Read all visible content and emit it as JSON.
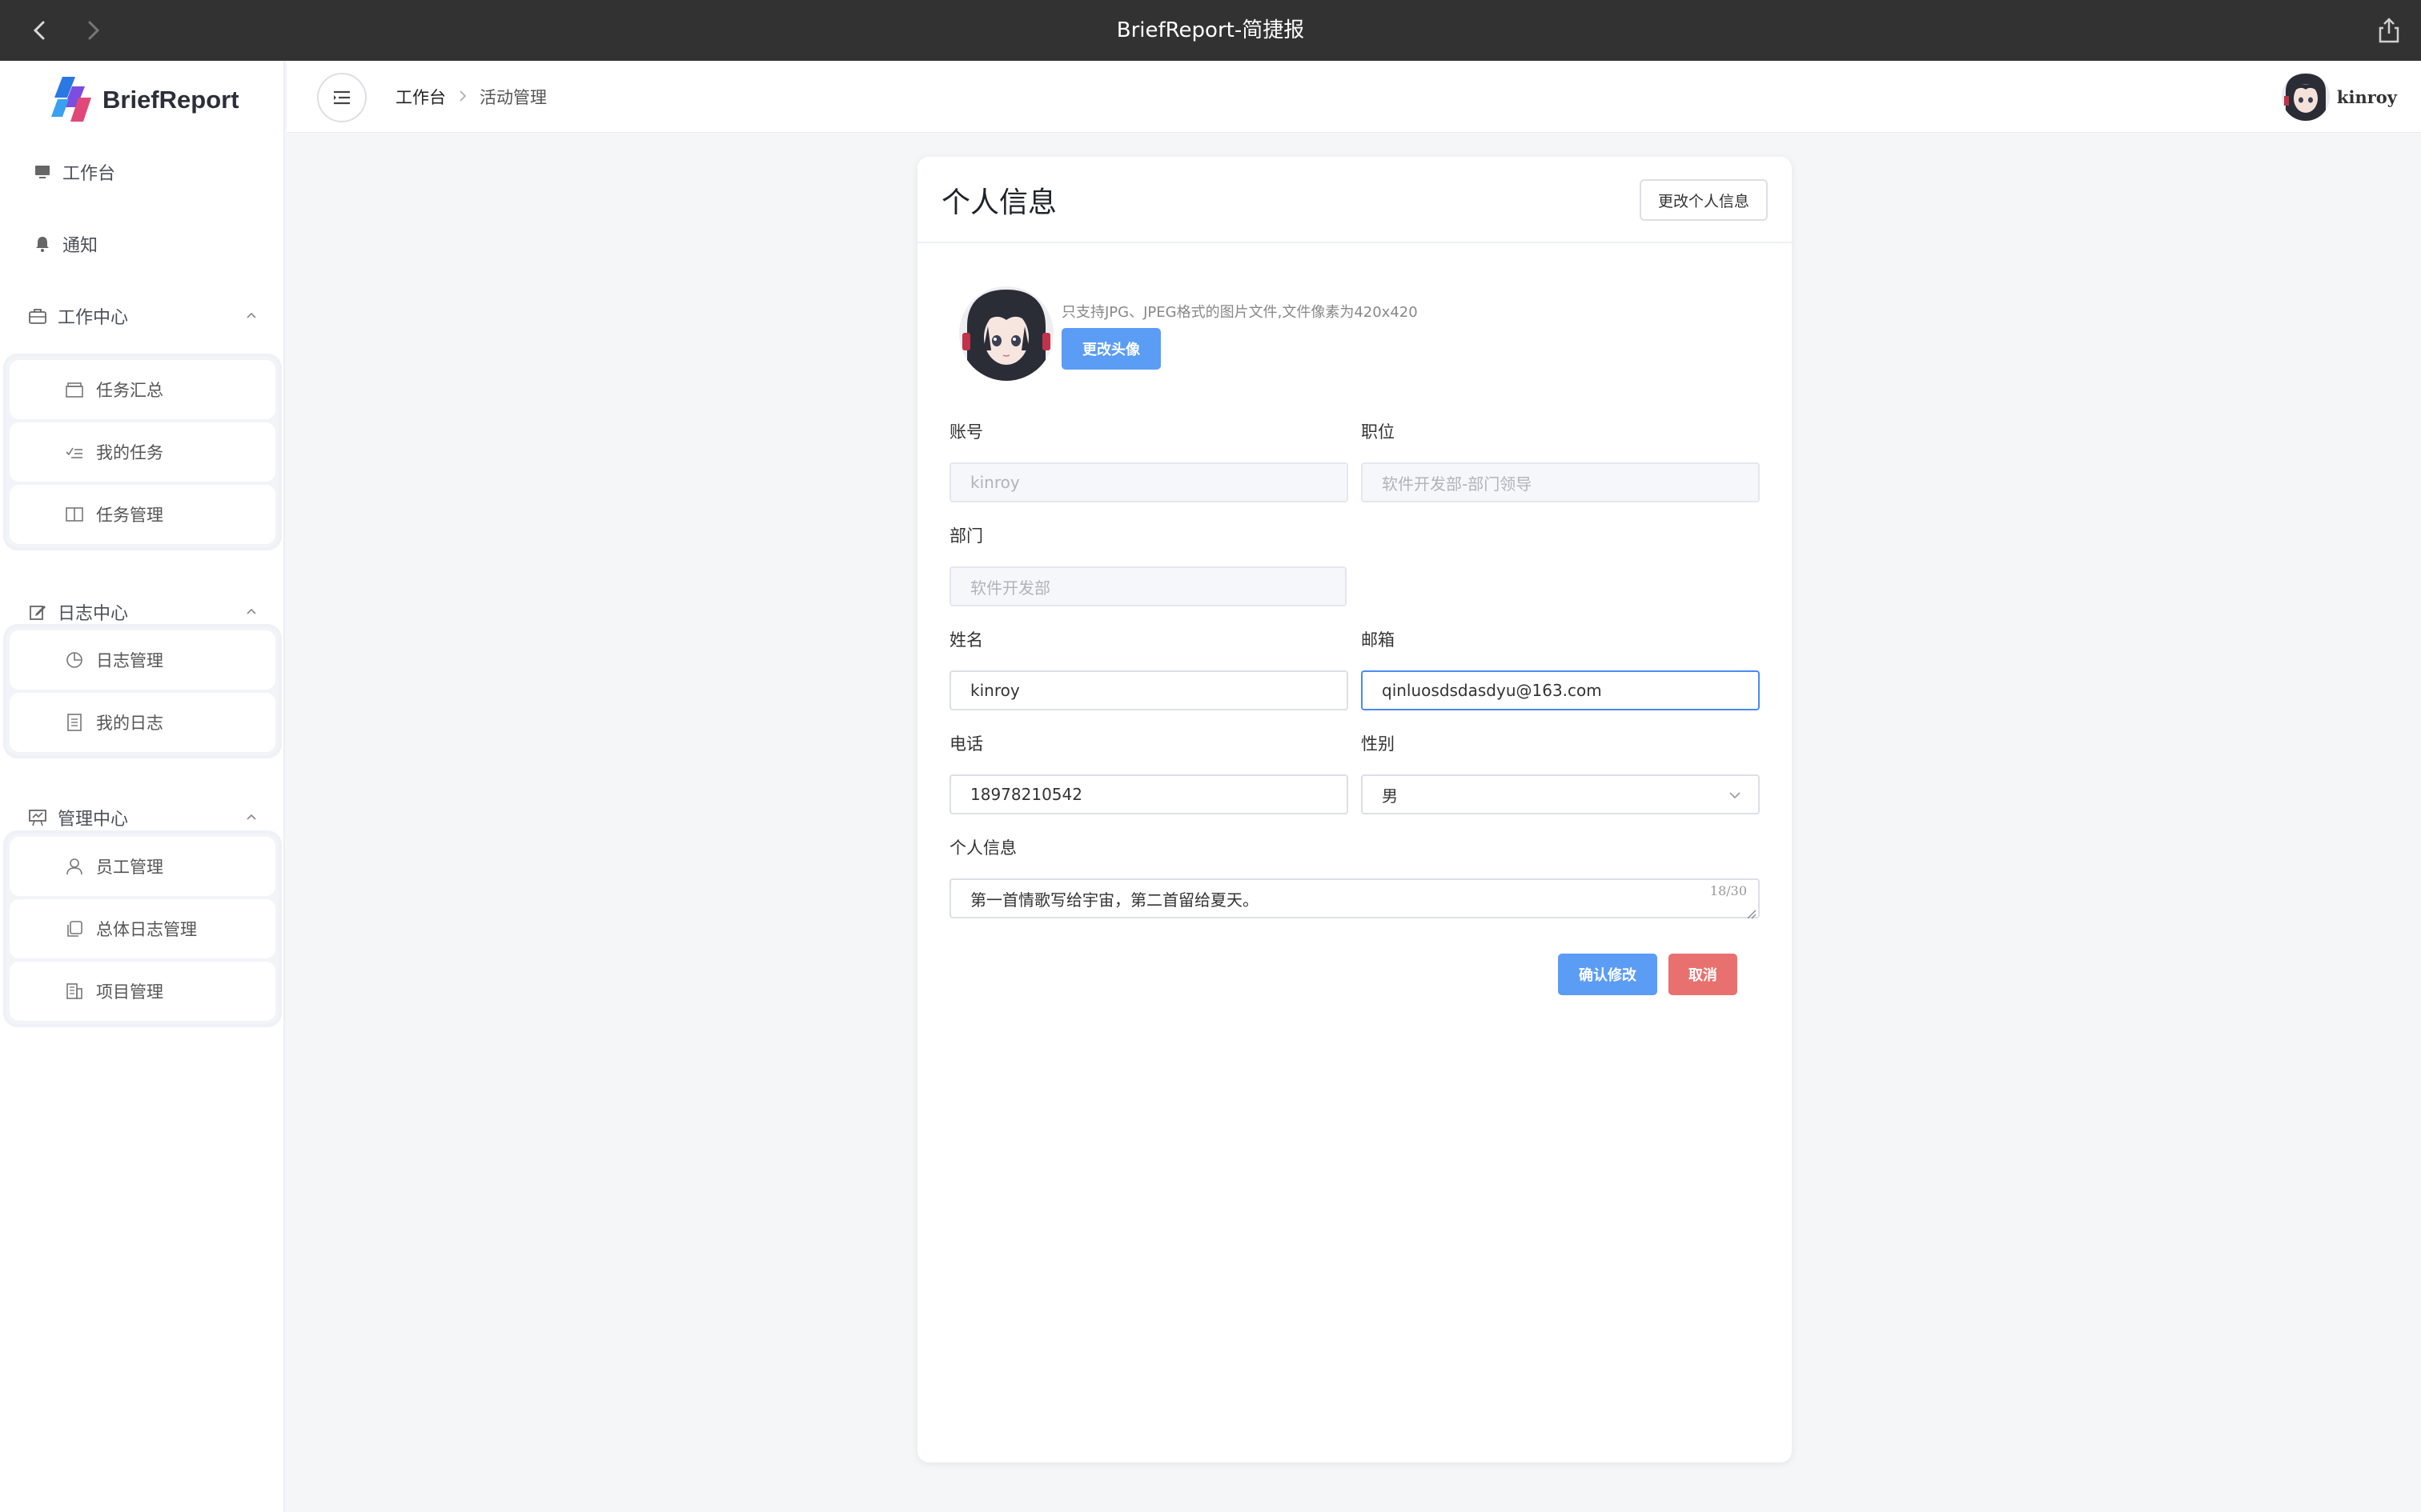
{
  "window": {
    "title": "BriefReport-简捷报"
  },
  "sidebar": {
    "logo_text": "BriefReport",
    "items": [
      {
        "label": "工作台",
        "icon": "monitor-icon"
      },
      {
        "label": "通知",
        "icon": "bell-icon"
      }
    ],
    "groups": [
      {
        "label": "工作中心",
        "icon": "briefcase-icon",
        "expanded": true,
        "children": [
          {
            "label": "任务汇总",
            "icon": "box-icon"
          },
          {
            "label": "我的任务",
            "icon": "checklist-icon"
          },
          {
            "label": "任务管理",
            "icon": "book-icon"
          }
        ]
      },
      {
        "label": "日志中心",
        "icon": "edit-icon",
        "expanded": true,
        "children": [
          {
            "label": "日志管理",
            "icon": "pie-chart-icon"
          },
          {
            "label": "我的日志",
            "icon": "document-icon"
          }
        ]
      },
      {
        "label": "管理中心",
        "icon": "presentation-icon",
        "expanded": true,
        "children": [
          {
            "label": "员工管理",
            "icon": "user-icon"
          },
          {
            "label": "总体日志管理",
            "icon": "copy-icon"
          },
          {
            "label": "项目管理",
            "icon": "building-icon"
          }
        ]
      }
    ]
  },
  "header": {
    "breadcrumb": [
      "工作台",
      "活动管理"
    ],
    "username": "kinroy"
  },
  "profile": {
    "title": "个人信息",
    "edit_button": "更改个人信息",
    "avatar_hint": "只支持JPG、JPEG格式的图片文件,文件像素为420x420",
    "change_avatar_button": "更改头像",
    "fields": {
      "account": {
        "label": "账号",
        "value": "kinroy"
      },
      "position": {
        "label": "职位",
        "value": "软件开发部-部门领导"
      },
      "department": {
        "label": "部门",
        "value": "软件开发部"
      },
      "name": {
        "label": "姓名",
        "value": "kinroy"
      },
      "email": {
        "label": "邮箱",
        "value": "qinluosdsdasdyu@163.com"
      },
      "phone": {
        "label": "电话",
        "value": "18978210542"
      },
      "gender": {
        "label": "性别",
        "value": "男"
      },
      "bio": {
        "label": "个人信息",
        "value": "第一首情歌写给宇宙，第二首留给夏天。",
        "counter": "18/30"
      }
    },
    "confirm_button": "确认修改",
    "cancel_button": "取消"
  },
  "colors": {
    "titlebar": "#323232",
    "primary": "#5b9cf5",
    "danger": "#e8716f",
    "focus_border": "#4a8af4"
  }
}
